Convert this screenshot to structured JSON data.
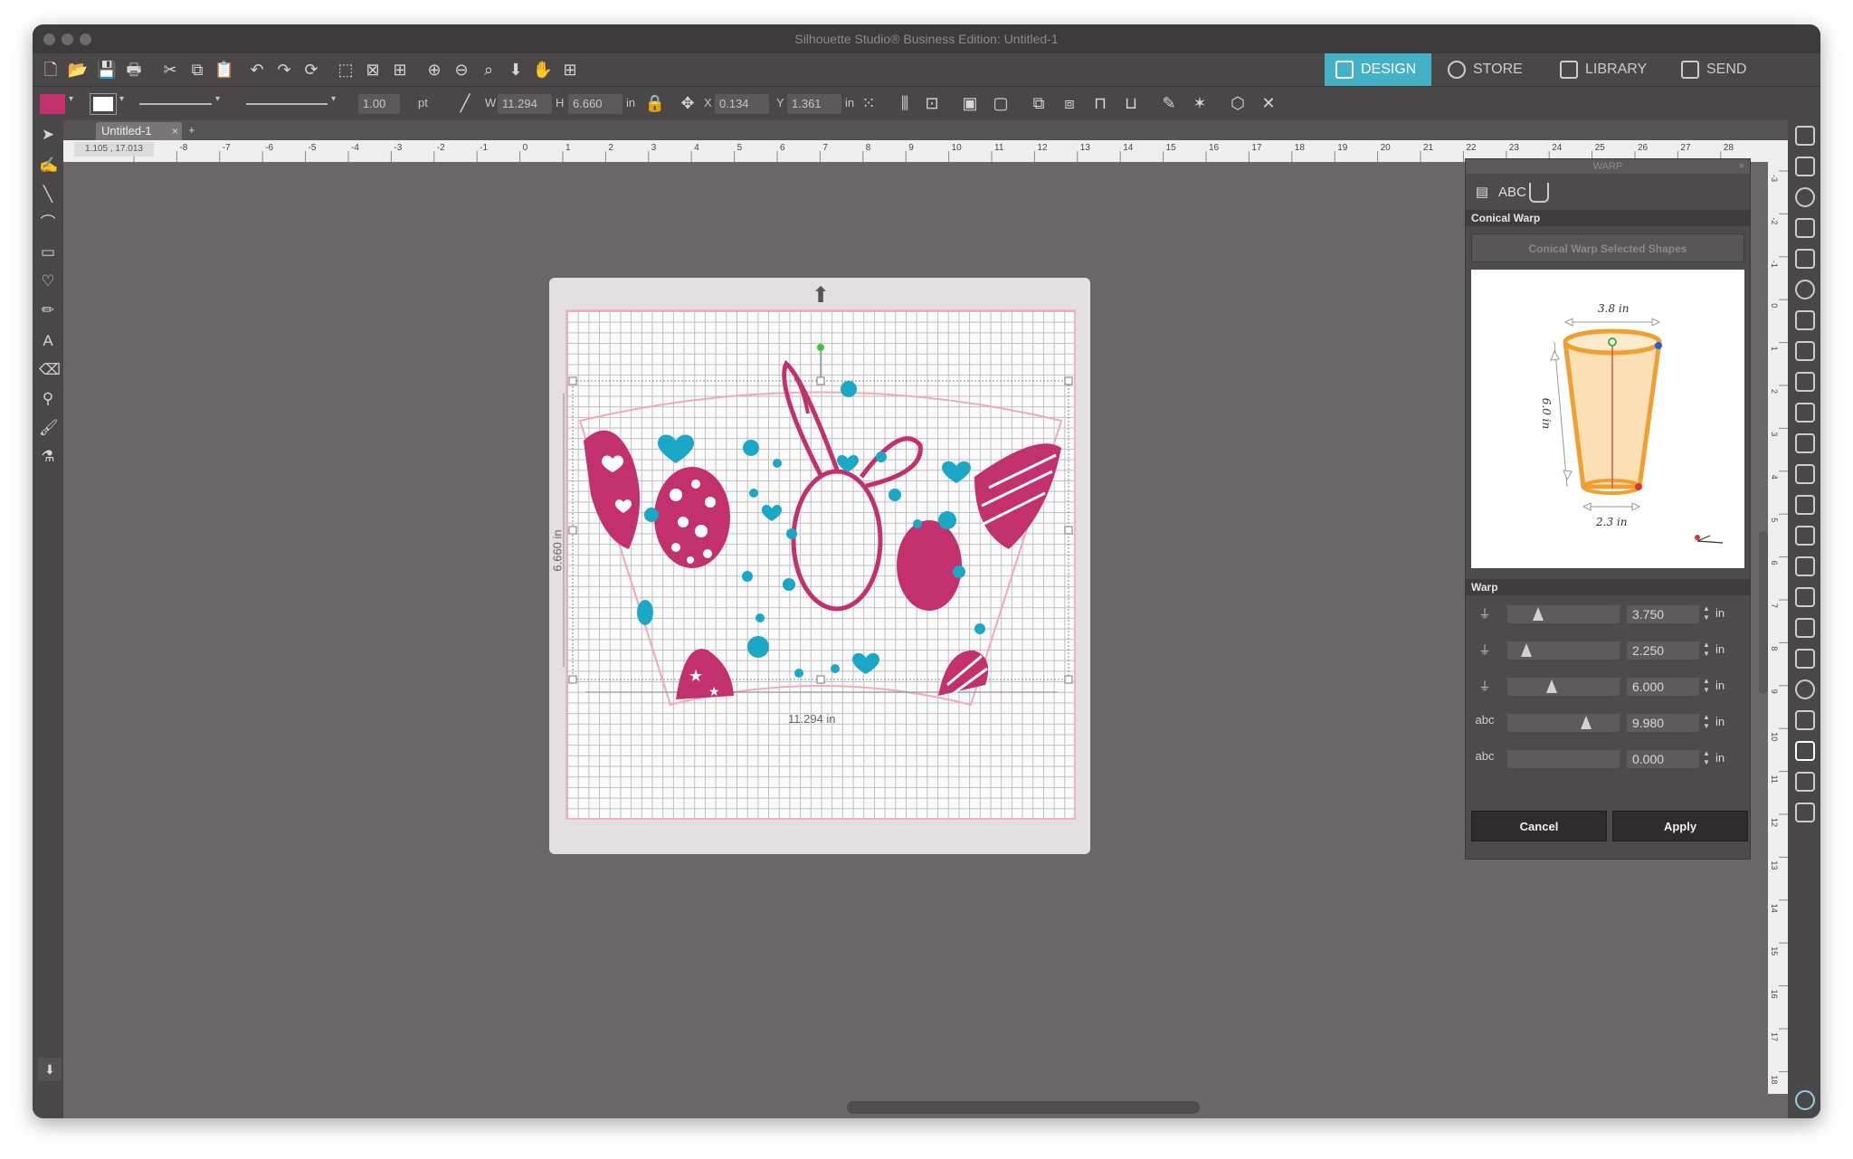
{
  "window": {
    "title": "Silhouette Studio® Business Edition: Untitled-1"
  },
  "nav_tabs": [
    {
      "label": "DESIGN",
      "active": true
    },
    {
      "label": "STORE",
      "active": false
    },
    {
      "label": "LIBRARY",
      "active": false
    },
    {
      "label": "SEND",
      "active": false
    }
  ],
  "toolbar": {
    "line_width": "1.00",
    "line_unit": "pt",
    "w_label": "W",
    "w_value": "11.294",
    "h_label": "H",
    "h_value": "6.660",
    "size_unit": "in",
    "x_label": "X",
    "x_value": "0.134",
    "y_label": "Y",
    "y_value": "1.361",
    "pos_unit": "in",
    "fill_color": "#c2306e"
  },
  "document": {
    "tab_name": "Untitled-1",
    "tab_close": "×",
    "add_tab": "+",
    "cursor_coords": "1.105 , 17.013"
  },
  "ruler": {
    "h_labels": [
      "-9",
      "-8",
      "-7",
      "-6",
      "-5",
      "-4",
      "-3",
      "-2",
      "-1",
      "0",
      "1",
      "2",
      "3",
      "4",
      "5",
      "6",
      "7",
      "8",
      "9",
      "10",
      "11",
      "12",
      "13",
      "14",
      "15",
      "16",
      "17",
      "18",
      "19",
      "20",
      "21",
      "22",
      "23",
      "24",
      "25",
      "26",
      "27",
      "28"
    ],
    "v_labels": [
      "-3",
      "-2",
      "-1",
      "0",
      "1",
      "2",
      "3",
      "4",
      "5",
      "6",
      "7",
      "8",
      "9",
      "10",
      "11",
      "12",
      "13",
      "14",
      "15",
      "16",
      "17",
      "18"
    ]
  },
  "canvas": {
    "width_dim": "11.294 in",
    "height_dim": "6.660 in"
  },
  "warp_panel": {
    "title": "WARP",
    "close": "×",
    "section_title": "Conical Warp",
    "action_button": "Conical Warp Selected Shapes",
    "preview": {
      "top_width": "3.8 in",
      "height": "6.0 in",
      "bottom_width": "2.3 in"
    },
    "warp_label": "Warp",
    "rows": [
      {
        "icon": "cup-top-icon",
        "value": "3.750",
        "unit": "in",
        "slider_fraction": 0.25
      },
      {
        "icon": "cup-bottom-icon",
        "value": "2.250",
        "unit": "in",
        "slider_fraction": 0.13
      },
      {
        "icon": "cup-height-icon",
        "value": "6.000",
        "unit": "in",
        "slider_fraction": 0.38
      },
      {
        "icon": "text-width-icon",
        "value": "9.980",
        "unit": "in",
        "slider_fraction": 0.72
      },
      {
        "icon": "text-offset-icon",
        "value": "0.000",
        "unit": "in",
        "slider_fraction": 0.0
      }
    ],
    "cancel_label": "Cancel",
    "apply_label": "Apply"
  },
  "colors": {
    "accent": "#43b2c6",
    "magenta": "#c2306e",
    "teal": "#1ba8c6",
    "cup_orange": "#f0a032",
    "cup_fill": "#fbe0b6"
  }
}
